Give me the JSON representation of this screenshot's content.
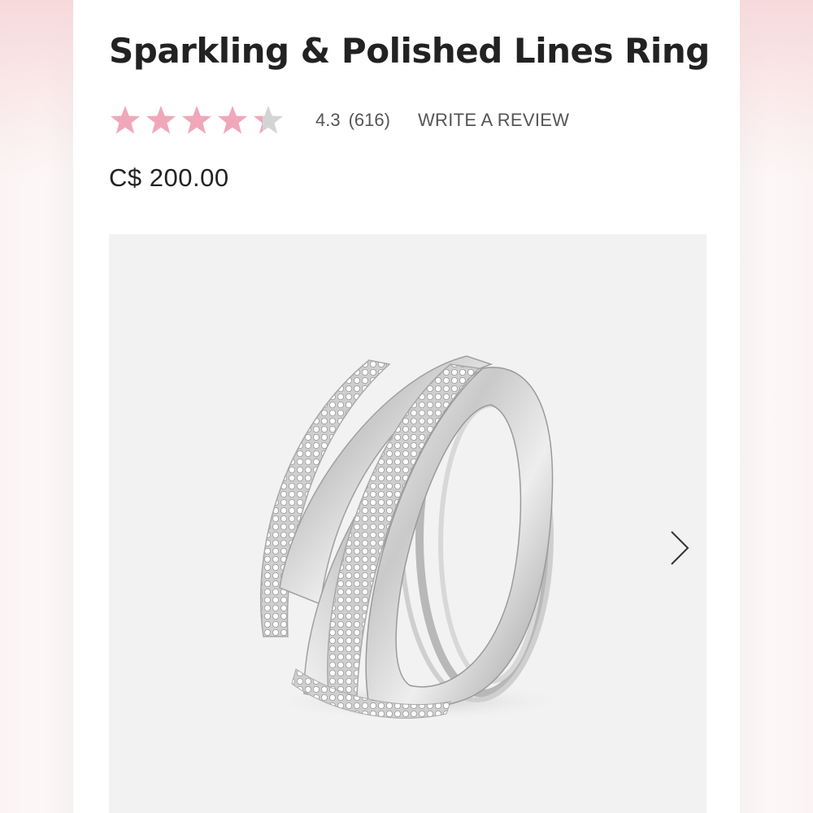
{
  "product": {
    "title": "Sparkling & Polished Lines Ring",
    "rating": {
      "value": "4.3",
      "count": "(616)",
      "stars_filled": 4.3,
      "stars_total": 5,
      "write_review_label": "WRITE A REVIEW"
    },
    "price": "C$ 200.00"
  },
  "gallery": {
    "image": "ring-photo",
    "next_icon": "chevron-right-icon"
  },
  "colors": {
    "star_filled": "#f1a7ba",
    "star_empty": "#d4d4d4",
    "image_background": "#f2f2f2",
    "title_text": "#222222"
  }
}
